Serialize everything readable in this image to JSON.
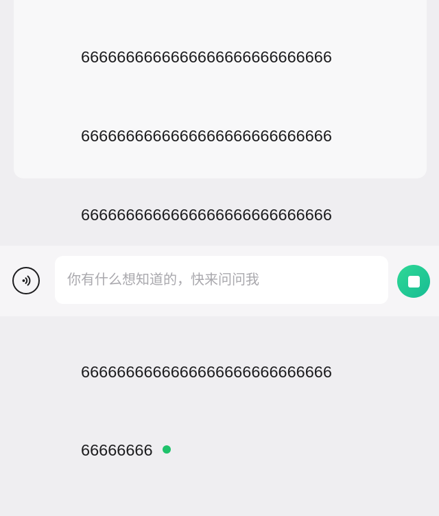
{
  "message": {
    "lines": [
      "6666666666666666666666666666",
      "6666666666666666666666666666",
      "6666666666666666666666666666",
      "6666666666666666666666666666",
      "6666666666666666666666666666",
      "66666666"
    ],
    "typing_dot_color": "#1fc26b"
  },
  "input_bar": {
    "voice_icon": "voice-wave-icon",
    "placeholder": "你有什么想知道的，快来问问我",
    "value": "",
    "stop_icon": "stop-square-icon",
    "accent_color": "#1fc993"
  }
}
